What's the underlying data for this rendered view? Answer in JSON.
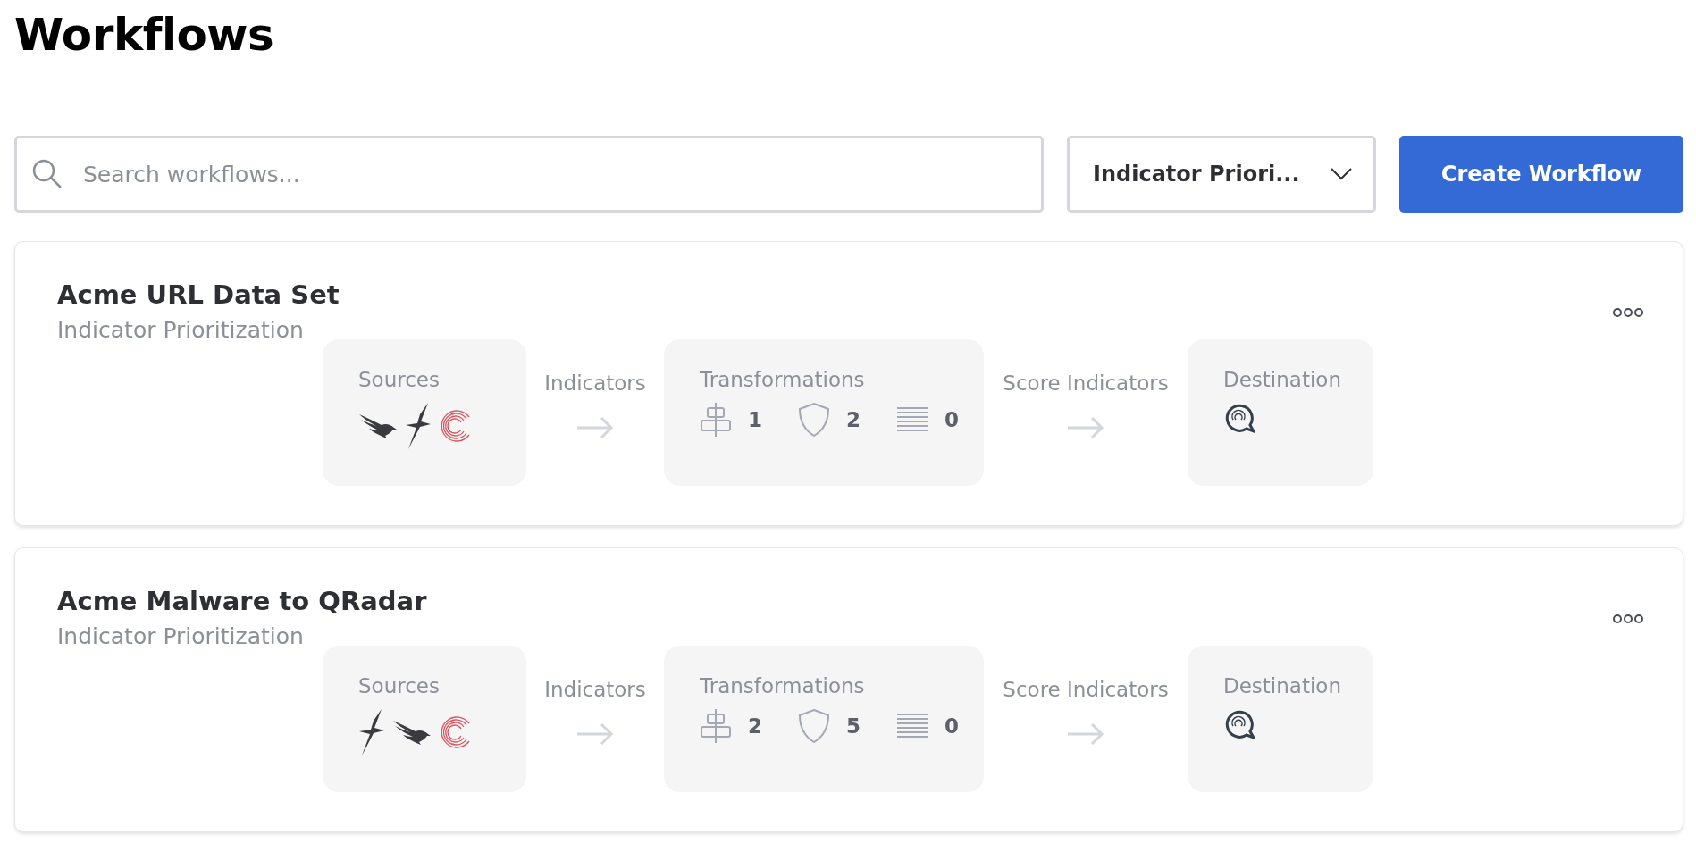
{
  "page": {
    "title": "Workflows"
  },
  "toolbar": {
    "search": {
      "placeholder": "Search workflows..."
    },
    "filter": {
      "value": "Indicator Priori..."
    },
    "create_button": "Create Workflow"
  },
  "workflows": [
    {
      "name": "Acme URL Data Set",
      "type": "Indicator Prioritization",
      "sources": {
        "label": "Sources",
        "icons": [
          {
            "kind": "bird"
          },
          {
            "kind": "star"
          },
          {
            "kind": "rings"
          }
        ]
      },
      "link_1": "Indicators",
      "transformations": {
        "label": "Transformations",
        "items": [
          {
            "kind": "split",
            "count": "1"
          },
          {
            "kind": "shield",
            "count": "2"
          },
          {
            "kind": "lines",
            "count": "0"
          }
        ]
      },
      "link_2": "Score Indicators",
      "destination": {
        "label": "Destination",
        "icons": [
          {
            "kind": "q"
          }
        ]
      }
    },
    {
      "name": "Acme Malware to QRadar",
      "type": "Indicator Prioritization",
      "sources": {
        "label": "Sources",
        "icons": [
          {
            "kind": "star"
          },
          {
            "kind": "bird"
          },
          {
            "kind": "rings"
          }
        ]
      },
      "link_1": "Indicators",
      "transformations": {
        "label": "Transformations",
        "items": [
          {
            "kind": "split",
            "count": "2"
          },
          {
            "kind": "shield",
            "count": "5"
          },
          {
            "kind": "lines",
            "count": "0"
          }
        ]
      },
      "link_2": "Score Indicators",
      "destination": {
        "label": "Destination",
        "icons": [
          {
            "kind": "q"
          }
        ]
      }
    }
  ]
}
